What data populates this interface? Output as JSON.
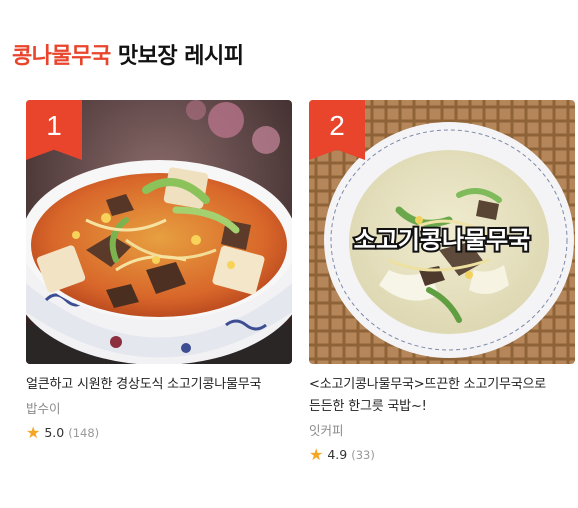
{
  "header": {
    "keyword": "콩나물무국",
    "rest": " 맛보장 레시피"
  },
  "recipes": [
    {
      "rank": "1",
      "title": "얼큰하고 시원한 경상도식 소고기콩나물무국",
      "author": "밥수이",
      "rating": "5.0",
      "review_count": "(148)",
      "image_icon": "spicy-beef-soup-photo"
    },
    {
      "rank": "2",
      "title": "<소고기콩나물무국>뜨끈한 소고기무국으로 든든한 한그릇 국밥~!",
      "author": "잇커피",
      "rating": "4.9",
      "review_count": "(33)",
      "image_overlay_text": "소고기콩나물무국",
      "image_icon": "clear-beef-soup-photo"
    }
  ],
  "colors": {
    "accent": "#e8452c",
    "star": "#f5a623"
  }
}
